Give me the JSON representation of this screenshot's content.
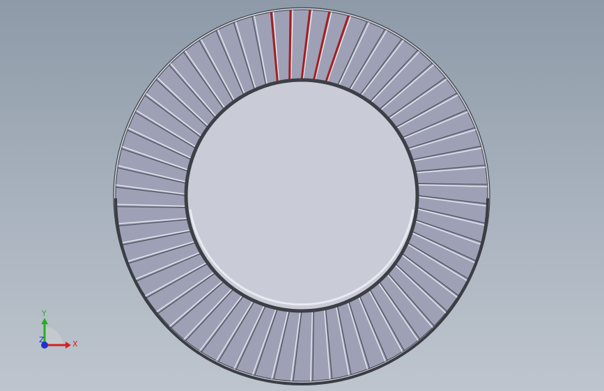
{
  "scene": {
    "background_top": "#8e9aa8",
    "background_bottom": "#bec5ce",
    "part": {
      "type": "serrated-lock-washer",
      "serration_count": 60,
      "face_color": "#9ea1b6",
      "outline_color": "#3c4046",
      "highlight_color": "#a51e1e",
      "highlighted_serrations": 5
    }
  },
  "triad": {
    "x_label": "X",
    "y_label": "Y",
    "z_label": "Z",
    "x_color": "#d42020",
    "y_color": "#22b022",
    "z_color": "#2030d0"
  }
}
